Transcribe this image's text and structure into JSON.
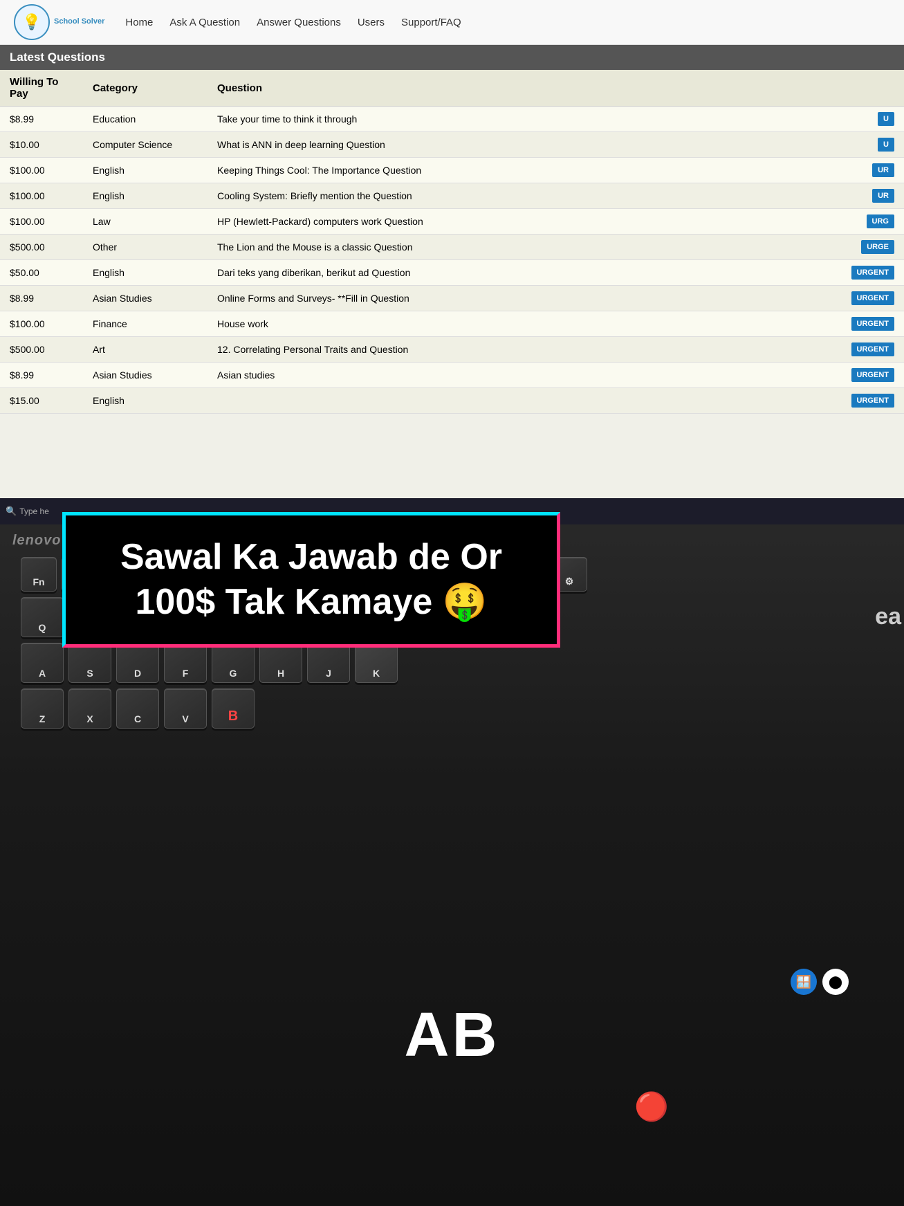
{
  "nav": {
    "logo_text": "School Solver",
    "logo_icon": "💡",
    "links": [
      "Home",
      "Ask A Question",
      "Answer Questions",
      "Users",
      "Support/FAQ"
    ]
  },
  "table": {
    "header": "Latest Questions",
    "columns": [
      "Willing To Pay",
      "Category",
      "Question"
    ],
    "rows": [
      {
        "pay": "$8.99",
        "category": "Education",
        "question": "Take your time to think it through",
        "btn": "U"
      },
      {
        "pay": "$10.00",
        "category": "Computer Science",
        "question": "What is ANN in deep learning Question",
        "btn": "U"
      },
      {
        "pay": "$100.00",
        "category": "English",
        "question": "Keeping Things Cool: The Importance Question",
        "btn": "UR"
      },
      {
        "pay": "$100.00",
        "category": "English",
        "question": "Cooling System: Briefly mention the Question",
        "btn": "UR"
      },
      {
        "pay": "$100.00",
        "category": "Law",
        "question": "HP (Hewlett-Packard) computers work Question",
        "btn": "URG"
      },
      {
        "pay": "$500.00",
        "category": "Other",
        "question": "The Lion and the Mouse is a classic Question",
        "btn": "URGE"
      },
      {
        "pay": "$50.00",
        "category": "English",
        "question": "Dari teks yang diberikan, berikut ad Question",
        "btn": "URGEN"
      },
      {
        "pay": "$8.99",
        "category": "Asian Studies",
        "question": "Online Forms and Surveys- **Fill in Question",
        "btn": "URGENT"
      },
      {
        "pay": "$100.00",
        "category": "Finance",
        "question": "House work",
        "btn": "URGENT"
      },
      {
        "pay": "$500.00",
        "category": "Art",
        "question": "12. Correlating Personal Traits and Question",
        "btn": "URGENT"
      },
      {
        "pay": "$8.99",
        "category": "Asian Studies",
        "question": "Asian studies",
        "btn": "URGENT"
      },
      {
        "pay": "$15.00",
        "category": "English",
        "question": "",
        "btn": "URGENT"
      }
    ]
  },
  "taskbar": {
    "search_placeholder": "Type he"
  },
  "banner": {
    "line1": "Sawal Ka Jawab de Or",
    "line2": "100$ Tak Kamaye 🤑"
  },
  "keyboard_brand": "lenovo",
  "ab_text": "AB",
  "partial_text": "ea"
}
